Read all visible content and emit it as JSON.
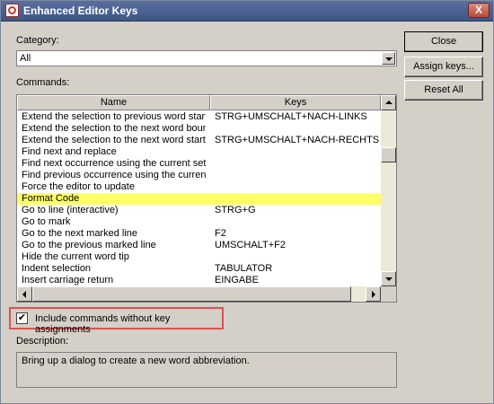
{
  "window": {
    "title": "Enhanced Editor Keys",
    "close_glyph": "X"
  },
  "category": {
    "label": "Category:",
    "value": "All"
  },
  "commands": {
    "label": "Commands:",
    "columns": [
      "Name",
      "Keys"
    ],
    "rows": [
      {
        "name": "Extend the selection to previous word start",
        "keys": "STRG+UMSCHALT+NACH-LINKS"
      },
      {
        "name": "Extend the selection to the next word boun",
        "keys": ""
      },
      {
        "name": "Extend the selection to the next word start",
        "keys": "STRG+UMSCHALT+NACH-RECHTS"
      },
      {
        "name": "Find next and replace",
        "keys": ""
      },
      {
        "name": "Find next occurrence using the current sett",
        "keys": ""
      },
      {
        "name": "Find previous occurrence using the current",
        "keys": ""
      },
      {
        "name": "Force the editor to update",
        "keys": ""
      },
      {
        "name": "Format Code",
        "keys": ""
      },
      {
        "name": "Go to line (interactive)",
        "keys": "STRG+G"
      },
      {
        "name": "Go to mark",
        "keys": ""
      },
      {
        "name": "Go to the next marked line",
        "keys": "F2"
      },
      {
        "name": "Go to the previous marked line",
        "keys": "UMSCHALT+F2"
      },
      {
        "name": "Hide the current word tip",
        "keys": ""
      },
      {
        "name": "Indent selection",
        "keys": "TABULATOR"
      },
      {
        "name": "Insert carriage return",
        "keys": "EINGABE"
      }
    ],
    "selected_index": 7
  },
  "buttons": {
    "close": "Close",
    "assign": "Assign keys...",
    "reset": "Reset All"
  },
  "include_unassigned": {
    "label": "Include commands without key assignments",
    "checked": true,
    "check_glyph": "✔"
  },
  "description": {
    "label": "Description:",
    "text": "Bring up a dialog to create a new word abbreviation."
  },
  "colors": {
    "selected_row": "#ffff66",
    "highlight_border": "#e05050"
  },
  "icons": {
    "app": "editor-app-icon"
  }
}
